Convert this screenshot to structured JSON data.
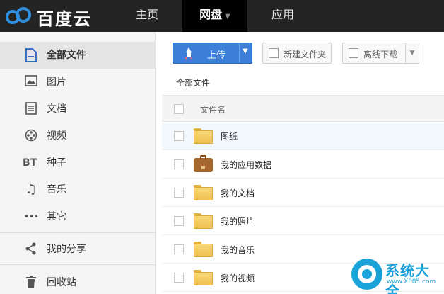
{
  "app": {
    "logo_text": "百度云"
  },
  "nav": {
    "home": "主页",
    "disk": "网盘",
    "apps": "应用"
  },
  "sidebar": {
    "items": [
      {
        "label": "全部文件",
        "icon": "document-icon",
        "active": true
      },
      {
        "label": "图片",
        "icon": "image-icon"
      },
      {
        "label": "文档",
        "icon": "text-document-icon"
      },
      {
        "label": "视频",
        "icon": "film-reel-icon"
      },
      {
        "label": "种子",
        "icon": "bt-icon",
        "icon_text": "BT"
      },
      {
        "label": "音乐",
        "icon": "music-note-icon"
      },
      {
        "label": "其它",
        "icon": "more-dots-icon"
      },
      {
        "label": "我的分享",
        "icon": "share-icon"
      },
      {
        "label": "回收站",
        "icon": "trash-icon"
      }
    ]
  },
  "toolbar": {
    "upload_label": "上传",
    "new_folder_label": "新建文件夹",
    "offline_download_label": "离线下载"
  },
  "breadcrumb": "全部文件",
  "list": {
    "column_name": "文件名",
    "rows": [
      {
        "name": "图纸",
        "type": "folder"
      },
      {
        "name": "我的应用数据",
        "type": "briefcase"
      },
      {
        "name": "我的文档",
        "type": "folder"
      },
      {
        "name": "我的照片",
        "type": "folder"
      },
      {
        "name": "我的音乐",
        "type": "folder"
      },
      {
        "name": "我的视频",
        "type": "folder"
      }
    ]
  },
  "watermark": {
    "title": "系统大全",
    "url": "www.XP85.com"
  },
  "colors": {
    "topbar": "#242424",
    "upload_button": "#3b7fd9",
    "folder": "#efc152",
    "watermark": "#1a9fd6"
  }
}
